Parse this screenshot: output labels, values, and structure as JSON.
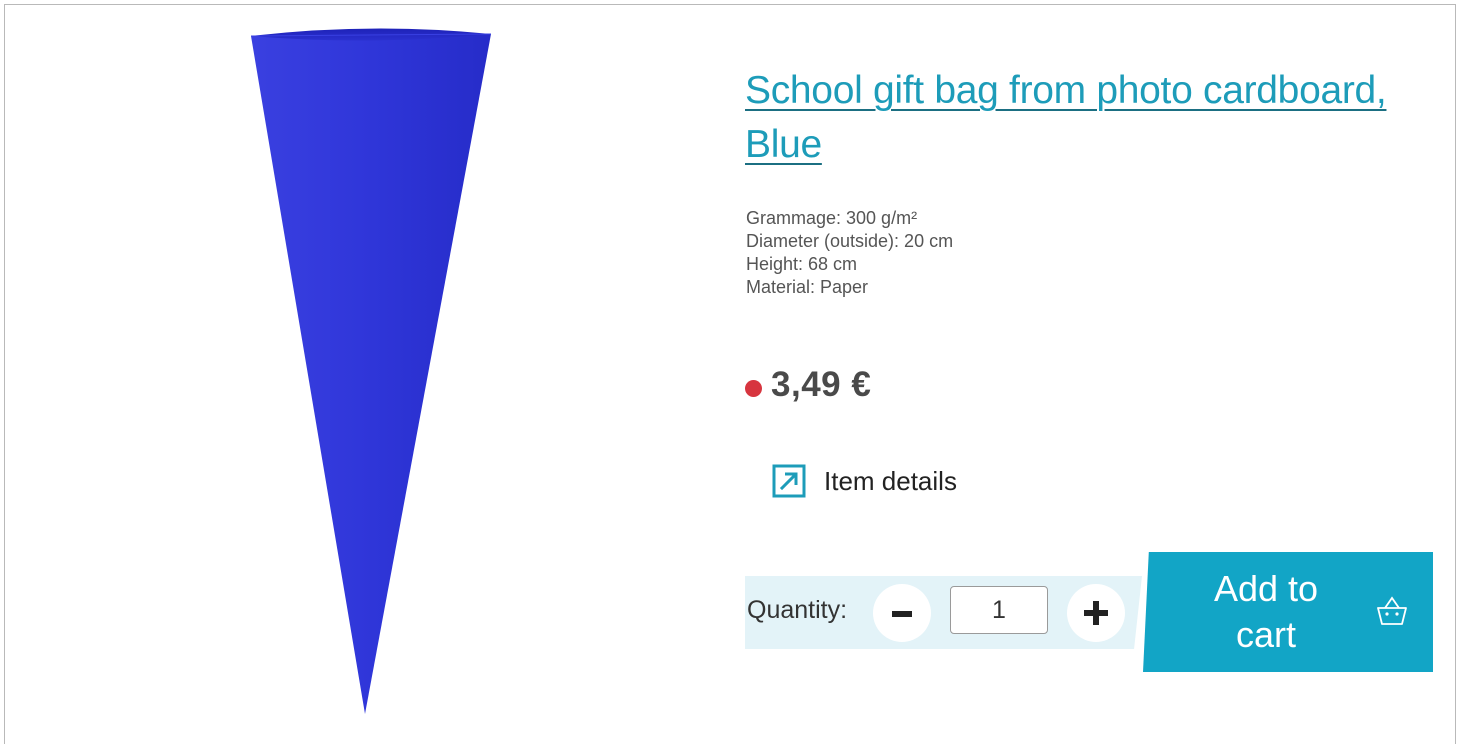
{
  "product": {
    "title": "School gift bag from photo cardboard, Blue",
    "image_color": "#2c33d6",
    "specs": [
      "Grammage: 300 g/m²",
      "Diameter (outside): 20 cm",
      "Height: 68 cm",
      "Material: Paper"
    ],
    "price": "3,49 €",
    "availability_color": "#d7353f",
    "details_link": "Item details"
  },
  "purchase": {
    "quantity_label": "Quantity:",
    "quantity_value": "1",
    "add_to_cart_line1": "Add to",
    "add_to_cart_line2": "cart"
  },
  "icons": {
    "details": "external-link-arrow-icon",
    "decrement": "minus-icon",
    "increment": "plus-icon",
    "cart": "shopping-basket-icon"
  },
  "colors": {
    "accent": "#12a5c6",
    "link": "#1d9cb9",
    "quantity_bg": "#e3f3f8"
  }
}
